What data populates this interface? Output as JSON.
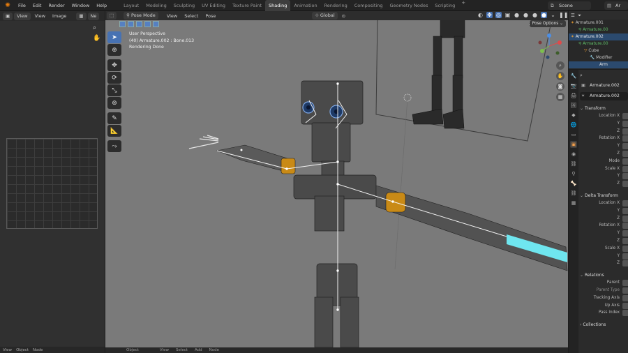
{
  "topbar": {
    "menus": [
      "File",
      "Edit",
      "Render",
      "Window",
      "Help"
    ],
    "workspaces": [
      "Layout",
      "Modeling",
      "Sculpting",
      "UV Editing",
      "Texture Paint",
      "Shading",
      "Animation",
      "Rendering",
      "Compositing",
      "Geometry Nodes",
      "Scripting"
    ],
    "active_workspace": "Shading",
    "add_tab": "+",
    "scene": "Scene",
    "view_layer": "Ar"
  },
  "left_editor": {
    "menus": [
      "View",
      "View",
      "Image"
    ],
    "new_label": "Ne",
    "footer": [
      "View",
      "Object",
      "Node"
    ]
  },
  "viewport": {
    "mode": "Pose Mode",
    "menus": [
      "View",
      "Select",
      "Pose"
    ],
    "orientation": "Global",
    "pose_options": "Pose Options",
    "close": "X",
    "info": [
      "User Perspective",
      "(40) Armature.002 : Bone.013",
      "Rendering Done"
    ],
    "accent_color": "#4772b3",
    "footer_menus": [
      "Object",
      "View",
      "Select",
      "Add",
      "Node"
    ]
  },
  "outliner": {
    "rows": [
      {
        "label": "Armature.001",
        "style": "normal"
      },
      {
        "label": "Armature.00",
        "style": "green"
      },
      {
        "label": "Armature.002",
        "style": "sel"
      },
      {
        "label": "Armature.00",
        "style": "green"
      },
      {
        "label": "Cube",
        "style": "normal"
      },
      {
        "label": "Modifier",
        "style": "normal"
      },
      {
        "label": "Arm",
        "style": "sel"
      }
    ]
  },
  "properties": {
    "object_name": "Armature.002",
    "data_name": "Armature.002",
    "transform": {
      "title": "Transform",
      "rows": [
        "Location X",
        "Y",
        "Z",
        "Rotation X",
        "Y",
        "Z",
        "Mode",
        "Scale X",
        "Y",
        "Z"
      ]
    },
    "delta": {
      "title": "Delta Transform",
      "rows": [
        "Location X",
        "Y",
        "Z",
        "Rotation X",
        "Y",
        "Z",
        "Scale X",
        "Y",
        "Z"
      ]
    },
    "relations": {
      "title": "Relations",
      "rows": [
        "Parent",
        "Parent Type",
        "Tracking Axis",
        "Up Axis",
        "Pass Index"
      ]
    },
    "collections": "Collections"
  }
}
